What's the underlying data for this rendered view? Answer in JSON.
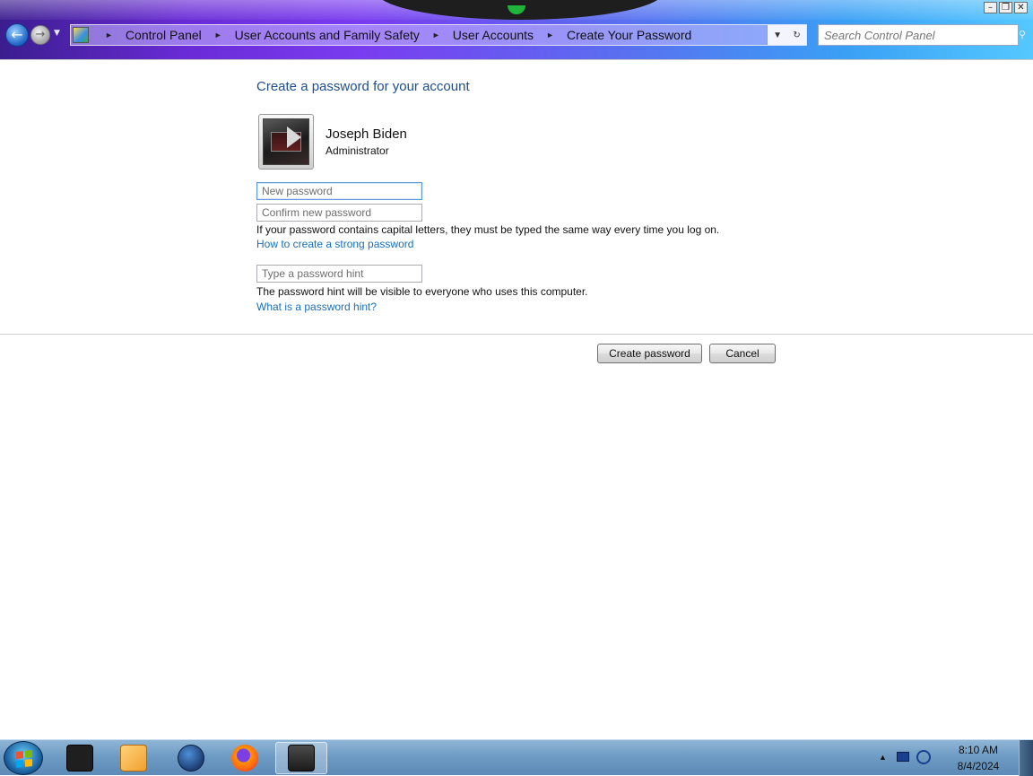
{
  "window": {
    "controls": [
      "minimize",
      "maximize",
      "close"
    ]
  },
  "address_bar": {
    "breadcrumbs": [
      "Control Panel",
      "User Accounts and Family Safety",
      "User Accounts",
      "Create Your Password"
    ]
  },
  "search": {
    "placeholder": "Search Control Panel"
  },
  "page": {
    "title": "Create a password for your account",
    "user_name": "Joseph Biden",
    "user_role": "Administrator",
    "new_password_placeholder": "New password",
    "confirm_password_placeholder": "Confirm new password",
    "capital_letters_note": "If your password contains capital letters, they must be typed the same way every time you log on.",
    "strong_password_link": "How to create a strong password",
    "hint_placeholder": "Type a password hint",
    "hint_note": "The password hint will be visible to everyone who uses this computer.",
    "hint_link": "What is a password hint?",
    "create_button": "Create password",
    "cancel_button": "Cancel"
  },
  "taskbar": {
    "apps": [
      {
        "icon": "terminal-icon",
        "color": "#1f1f1f"
      },
      {
        "icon": "media-player-icon",
        "color": "#f0a030"
      },
      {
        "icon": "globe-icon",
        "color": "#1d3f73"
      },
      {
        "icon": "firefox-icon",
        "color": "#ff6a13"
      },
      {
        "icon": "control-panel-icon",
        "color": "#2a2a2a"
      }
    ],
    "time": "8:10 AM",
    "date": "8/4/2024"
  },
  "colors": {
    "title_blue": "#1e4e8c",
    "link_blue": "#1a6fb7"
  }
}
